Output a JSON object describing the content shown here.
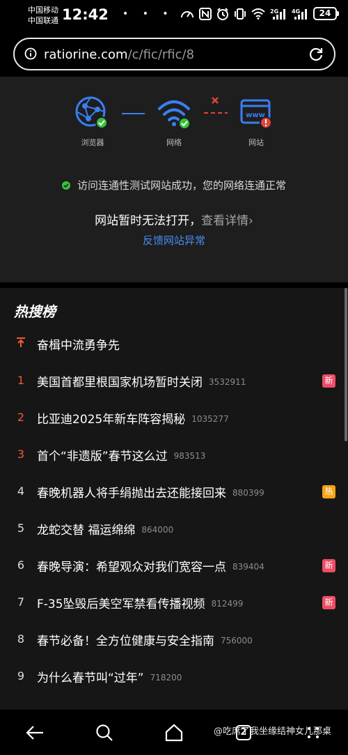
{
  "status_bar": {
    "carrier_1": "中国移动",
    "carrier_2": "中国联通",
    "time": "12:42",
    "dots": "• • •",
    "net_label_1": "2G",
    "net_label_2": "4G",
    "battery": "24"
  },
  "url_bar": {
    "domain": "ratiorine.com",
    "path": "/c/fic/rfic/8"
  },
  "diagnosis": {
    "browser_label": "浏览器",
    "network_label": "网络",
    "website_label": "网站",
    "website_icon_text": "www",
    "ok_message": "访问连通性测试网站成功，您的网络连通正常",
    "main_message": "网站暂时无法打开，",
    "details_link": "查看详情",
    "details_arrow": "›",
    "feedback_link": "反馈网站异常"
  },
  "hot_list": {
    "title": "热搜榜",
    "items": [
      {
        "rank": "",
        "text": "奋楫中流勇争先",
        "count": "",
        "badge": ""
      },
      {
        "rank": "1",
        "text": "美国首都里根国家机场暂时关闭",
        "count": "3532911",
        "badge": "新"
      },
      {
        "rank": "2",
        "text": "比亚迪2025年新车阵容揭秘",
        "count": "1035277",
        "badge": ""
      },
      {
        "rank": "3",
        "text": "首个“非遗版”春节这么过",
        "count": "983513",
        "badge": ""
      },
      {
        "rank": "4",
        "text": "春晚机器人将手绢抛出去还能接回来",
        "count": "880399",
        "badge": "热"
      },
      {
        "rank": "5",
        "text": "龙蛇交替 福运绵绵",
        "count": "864000",
        "badge": ""
      },
      {
        "rank": "6",
        "text": "春晚导演：希望观众对我们宽容一点",
        "count": "839404",
        "badge": "新"
      },
      {
        "rank": "7",
        "text": "F-35坠毁后美空军禁看传播视频",
        "count": "812499",
        "badge": "新"
      },
      {
        "rank": "8",
        "text": "春节必备！全方位健康与安全指南",
        "count": "756000",
        "badge": ""
      },
      {
        "rank": "9",
        "text": "为什么春节叫“过年”",
        "count": "718200",
        "badge": ""
      }
    ]
  },
  "nav_bar": {
    "tab_count": "2",
    "watermark": "@吃席了我坐缘结神女儿那桌"
  },
  "colors": {
    "accent_blue": "#4a8cf0",
    "success_green": "#37c23e",
    "error_red": "#e0453a",
    "rank_orange": "#f05b34",
    "badge_new": "#f04c66",
    "badge_hot": "#f5a312"
  }
}
